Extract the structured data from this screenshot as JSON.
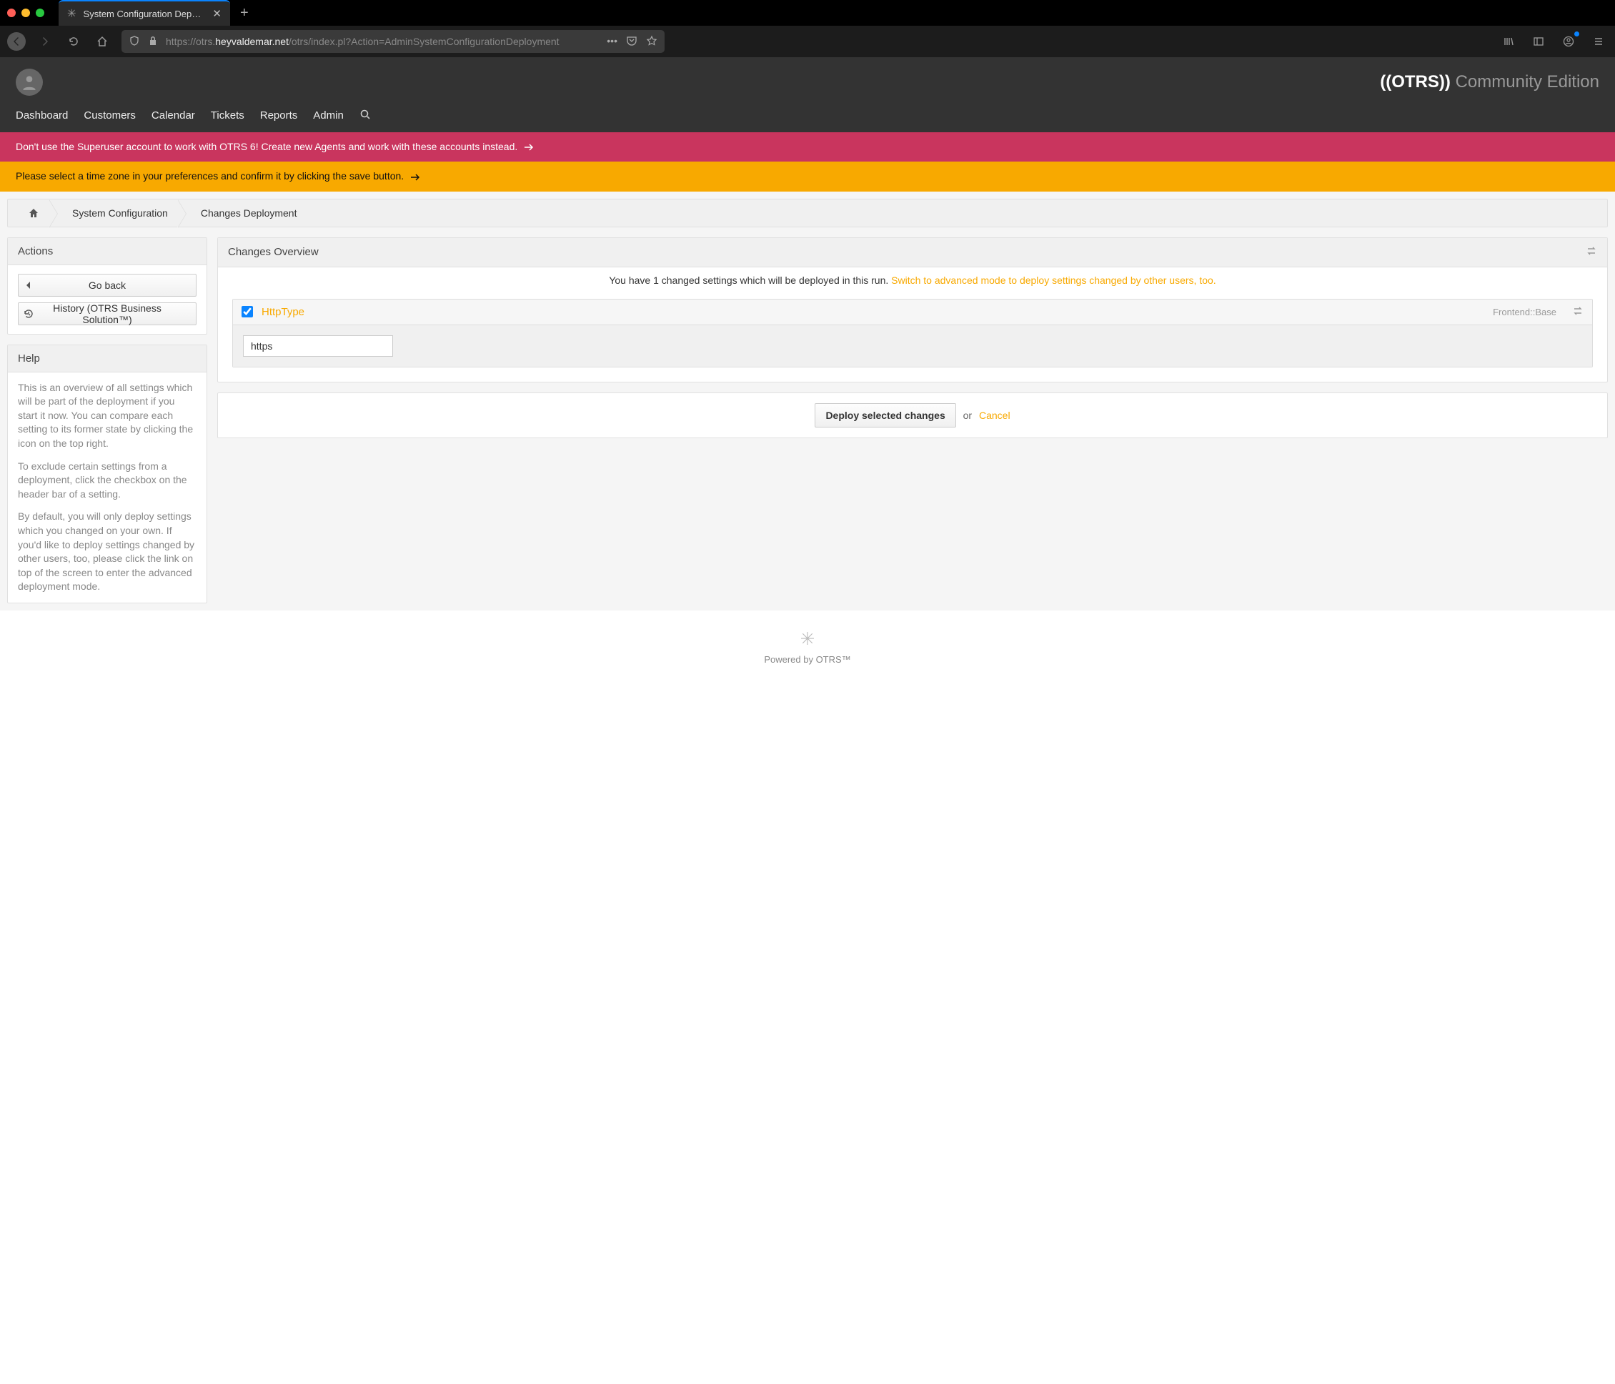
{
  "browser": {
    "tab_title": "System Configuration Deployme",
    "url_prefix": "https://otrs.",
    "url_domain": "heyvaldemar.net",
    "url_path": "/otrs/index.pl?Action=AdminSystemConfigurationDeployment"
  },
  "brand": {
    "strong": "((OTRS))",
    "sub": "Community Edition"
  },
  "nav": {
    "dashboard": "Dashboard",
    "customers": "Customers",
    "calendar": "Calendar",
    "tickets": "Tickets",
    "reports": "Reports",
    "admin": "Admin"
  },
  "banners": {
    "red": "Don't use the Superuser account to work with OTRS 6! Create new Agents and work with these accounts instead.",
    "yellow": "Please select a time zone in your preferences and confirm it by clicking the save button."
  },
  "breadcrumb": {
    "sysconfig": "System Configuration",
    "deploy": "Changes Deployment"
  },
  "sidebar": {
    "actions_title": "Actions",
    "go_back": "Go back",
    "history": "History (OTRS Business Solution™)",
    "help_title": "Help",
    "help_p1": "This is an overview of all settings which will be part of the deployment if you start it now. You can compare each setting to its former state by clicking the icon on the top right.",
    "help_p2": "To exclude certain settings from a deployment, click the checkbox on the header bar of a setting.",
    "help_p3": "By default, you will only deploy settings which you changed on your own. If you'd like to deploy settings changed by other users, too, please click the link on top of the screen to enter the advanced deployment mode."
  },
  "main": {
    "overview_title": "Changes Overview",
    "overview_msg": "You have 1 changed settings which will be deployed in this run. ",
    "overview_link": "Switch to advanced mode to deploy settings changed by other users, too.",
    "setting_name": "HttpType",
    "setting_category": "Frontend::Base",
    "setting_value": "https",
    "deploy_btn": "Deploy selected changes",
    "or": " or ",
    "cancel": "Cancel"
  },
  "footer": {
    "powered": "Powered by OTRS™"
  }
}
